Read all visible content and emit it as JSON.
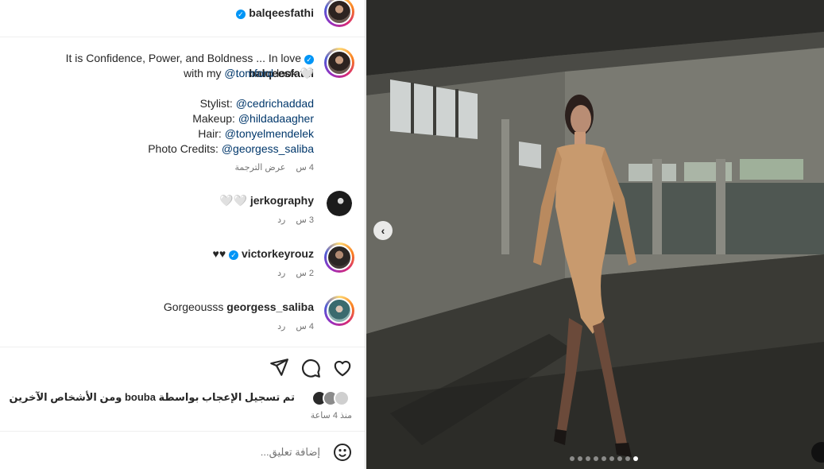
{
  "post": {
    "author": "balqeesfathi",
    "caption": {
      "line1_prefix": "It is Confidence, Power, and Boldness ... In love",
      "line2_prefix": "with my",
      "mention_brand": "@tomford",
      "line2_suffix": "look 🤍",
      "credits": [
        {
          "label": "Stylist:",
          "handle": "@cedrichaddad"
        },
        {
          "label": "Makeup:",
          "handle": "@hildadaagher"
        },
        {
          "label": "Hair:",
          "handle": "@tonyelmendelek"
        },
        {
          "label": "Photo Credits:",
          "handle": "@georgess_saliba"
        }
      ],
      "time": "4 س",
      "translate": "عرض الترجمة"
    },
    "comments": [
      {
        "user": "jerkography",
        "text": "🤍🤍",
        "time": "3 س",
        "reply": "رد"
      },
      {
        "user": "victorkeyrouz",
        "text": "♥♥",
        "time": "2 س",
        "reply": "رد"
      },
      {
        "user": "georgess_saliba",
        "text": "Gorgeousss",
        "time": "4 س",
        "reply": "رد"
      }
    ],
    "likes_text": "تم تسجيل الإعجاب بواسطة bouba ومن الأشخاص الآخرين",
    "posted_time": "منذ 4 ساعة",
    "comment_placeholder": "إضافة تعليق..."
  },
  "carousel": {
    "total": 9,
    "active_index": 8
  },
  "icons": [
    "share-icon",
    "comment-icon",
    "heart-icon",
    "emoji-icon",
    "verified-icon",
    "chevron-left-icon"
  ],
  "colors": {
    "link": "#00376b",
    "verified": "#0095f6",
    "muted": "#737373"
  }
}
